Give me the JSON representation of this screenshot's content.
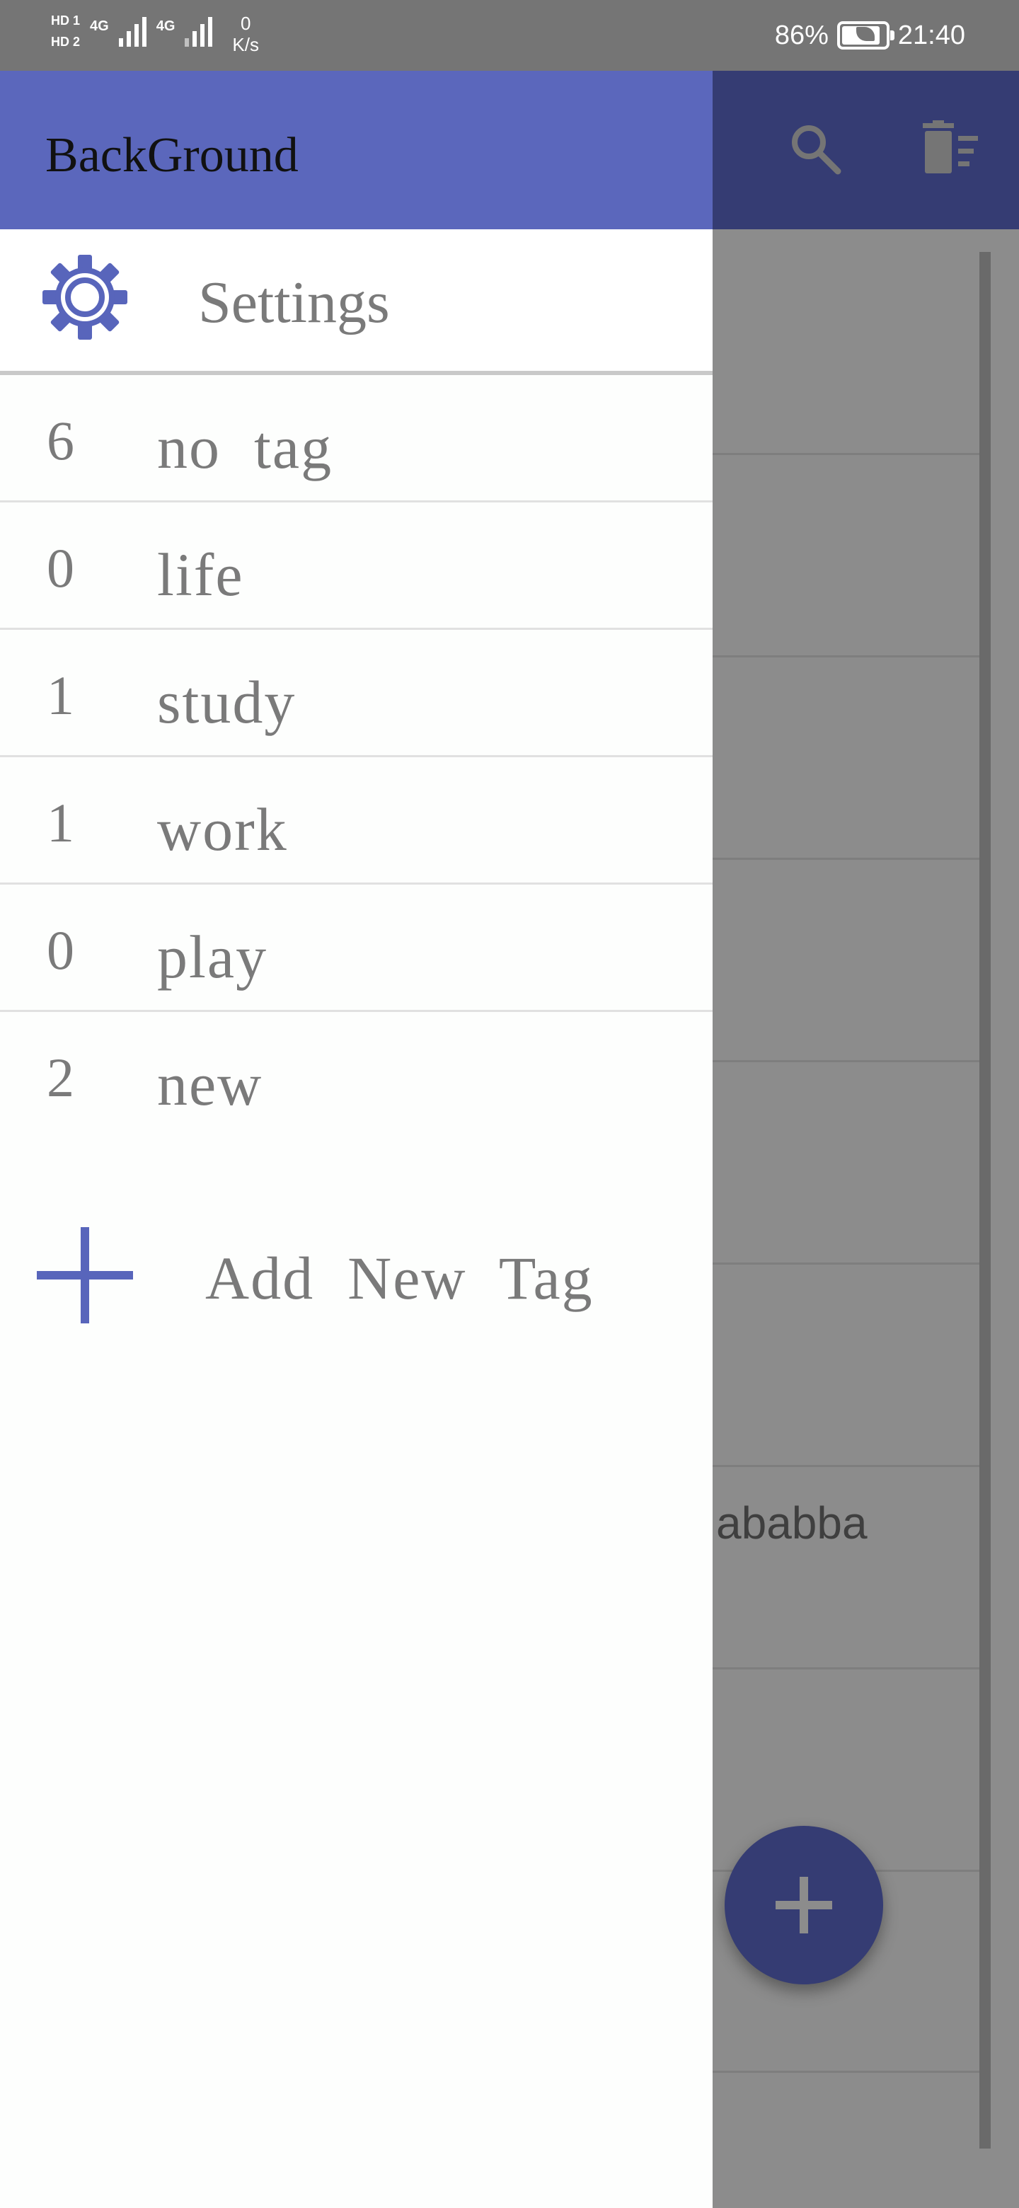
{
  "status_bar": {
    "sim1_label": "HD 1",
    "sim2_label": "HD 2",
    "network1": "4G",
    "network2": "4G",
    "speed_value": "0",
    "speed_unit": "K/s",
    "battery_percent": "86%",
    "time": "21:40"
  },
  "app_bar": {
    "search_icon": "search-icon",
    "delete_sort_icon": "delete-sort-icon"
  },
  "drawer": {
    "title": "BackGround",
    "settings_label": "Settings",
    "settings_icon": "gear-icon",
    "tags": [
      {
        "count": "6",
        "name": "no  tag"
      },
      {
        "count": "0",
        "name": "life"
      },
      {
        "count": "1",
        "name": "study"
      },
      {
        "count": "1",
        "name": "work"
      },
      {
        "count": "0",
        "name": "play"
      },
      {
        "count": "2",
        "name": "new"
      }
    ],
    "add_tag_label": "Add  New  Tag",
    "add_tag_icon": "plus-icon"
  },
  "main": {
    "note_snippet": "ababba",
    "fab_icon": "plus-icon"
  },
  "colors": {
    "drawer_header": "#5b67bc",
    "main_appbar_dimmed": "#353c73",
    "accent": "#5865bb",
    "scrim_content": "#8c8c8c"
  }
}
